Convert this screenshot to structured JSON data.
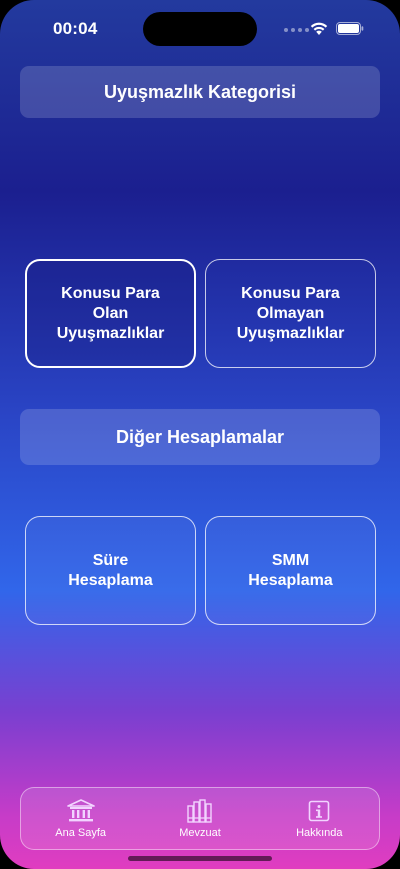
{
  "status_bar": {
    "time": "00:04"
  },
  "sections": {
    "category_title": "Uyuşmazlık Kategorisi",
    "other_title": "Diğer Hesaplamalar"
  },
  "cards": {
    "monetary": "Konusu Para\nOlan\nUyuşmazlıklar",
    "non_monetary": "Konusu Para\nOlmayan\nUyuşmazlıklar",
    "duration": "Süre\nHesaplama",
    "smm": "SMM\nHesaplama"
  },
  "tab_bar": {
    "items": [
      {
        "label": "Ana Sayfa",
        "icon": "courthouse-icon"
      },
      {
        "label": "Mevzuat",
        "icon": "books-icon"
      },
      {
        "label": "Hakkında",
        "icon": "info-icon"
      }
    ]
  },
  "colors": {
    "gradient_top": "#233a9e",
    "gradient_mid": "#3166ea",
    "gradient_bottom": "#e03dc0"
  }
}
